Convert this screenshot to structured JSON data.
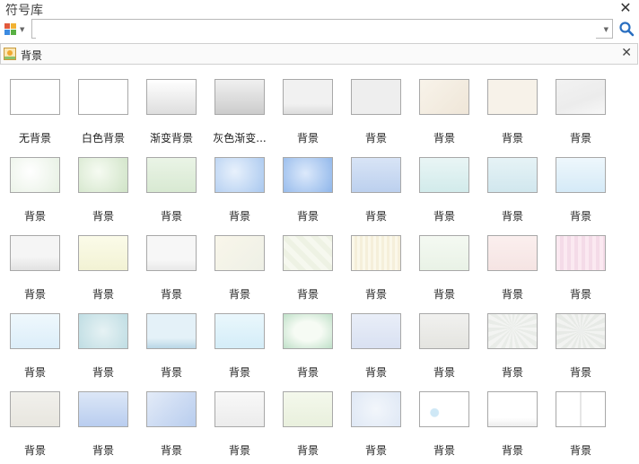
{
  "window": {
    "title": "符号库"
  },
  "search": {
    "value": "",
    "placeholder": ""
  },
  "library": {
    "name": "背景"
  },
  "items": [
    {
      "label": "无背景",
      "bg": "#ffffff"
    },
    {
      "label": "白色背景",
      "bg": "#ffffff"
    },
    {
      "label": "渐变背景",
      "bg": "linear-gradient(#ffffff,#dedede)"
    },
    {
      "label": "灰色渐变...",
      "bg": "linear-gradient(#f0f0f0,#cccccc)"
    },
    {
      "label": "背景",
      "bg": "linear-gradient(#f1f1f1 70%,#dcdcdc)"
    },
    {
      "label": "背景",
      "bg": "#eeeeee"
    },
    {
      "label": "背景",
      "bg": "linear-gradient(135deg,#f8f3ea,#efe6d8)"
    },
    {
      "label": "背景",
      "bg": "#f7f2e9"
    },
    {
      "label": "背景",
      "bg": "linear-gradient(160deg,#f2f2f2,#ececec 60%,#f7f7f7)"
    },
    {
      "label": "背景",
      "bg": "radial-gradient(circle at 40% 40%,#ffffff,#e6f0e2)"
    },
    {
      "label": "背景",
      "bg": "radial-gradient(circle at 40% 40%,#f6fbf2,#cfe3c6)"
    },
    {
      "label": "背景",
      "bg": "linear-gradient(#eaf4e6,#d8e9d2)"
    },
    {
      "label": "背景",
      "bg": "radial-gradient(circle at 40% 40%,#e8f1fc,#a9c8ef)"
    },
    {
      "label": "背景",
      "bg": "radial-gradient(circle at 45% 45%,#dce9fb,#8fb6ea)"
    },
    {
      "label": "背景",
      "bg": "linear-gradient(#d8e4f6,#bcd0ee)"
    },
    {
      "label": "背景",
      "bg": "linear-gradient(#e9f5f5,#d2ebeb)"
    },
    {
      "label": "背景",
      "bg": "linear-gradient(#e6f3f6,#d1e7ee)"
    },
    {
      "label": "背景",
      "bg": "linear-gradient(#eef7fc,#d5eaf7)"
    },
    {
      "label": "背景",
      "bg": "linear-gradient(#f5f5f5 60%,#e2e2e2)"
    },
    {
      "label": "背景",
      "bg": "linear-gradient(#fbfbe9,#f2f2d4)"
    },
    {
      "label": "背景",
      "bg": "linear-gradient(#f7f7f7 70%,#e9e9e9)"
    },
    {
      "label": "背景",
      "bg": "linear-gradient(135deg,#f9f6ea,#eef0e6)"
    },
    {
      "label": "背景",
      "bg": "repeating-linear-gradient(45deg,#eef2e4 0 6px,#f6f8ef 6px 12px)"
    },
    {
      "label": "背景",
      "bg": "repeating-linear-gradient(90deg,#fbf8ea 0 3px,#f5efda 3px 6px)"
    },
    {
      "label": "背景",
      "bg": "linear-gradient(#f4f9f2,#e9f2e6)"
    },
    {
      "label": "背景",
      "bg": "linear-gradient(#fbefee,#f5e4e3)"
    },
    {
      "label": "背景",
      "bg": "repeating-linear-gradient(90deg,#fbe9f1 0 4px,#f4dbe8 4px 8px)"
    },
    {
      "label": "背景",
      "bg": "linear-gradient(#eff8fd,#dceef9)"
    },
    {
      "label": "背景",
      "bg": "radial-gradient(circle at 50% 50%,#e6f2f4,#bfdde3)"
    },
    {
      "label": "背景",
      "bg": "linear-gradient(#e4f1f8 70%,#b9d6e6)"
    },
    {
      "label": "背景",
      "bg": "linear-gradient(#eaf7fc,#d4edf8)"
    },
    {
      "label": "背景",
      "bg": "radial-gradient(ellipse at 50% 50%,#f6fbf4 40%,#bfe0c8)"
    },
    {
      "label": "背景",
      "bg": "linear-gradient(#e9eef8,#d9e1f2)"
    },
    {
      "label": "背景",
      "bg": "linear-gradient(#f1f1ef,#e4e4e0)"
    },
    {
      "label": "背景",
      "bg": "repeating-conic-gradient(from 0deg at 50% 40%,#e9ece8 0 10deg,#f3f4f2 10deg 20deg)"
    },
    {
      "label": "背景",
      "bg": "repeating-conic-gradient(from 0deg at 50% 50%,#e7eae6 0 10deg,#f2f3f1 10deg 20deg)"
    },
    {
      "label": "背景",
      "bg": "linear-gradient(#f1f0ec,#e8e6df)"
    },
    {
      "label": "背景",
      "bg": "linear-gradient(#dce7f7,#b9cdef)"
    },
    {
      "label": "背景",
      "bg": "linear-gradient(135deg,#e3ebf8,#b8cdee)"
    },
    {
      "label": "背景",
      "bg": "linear-gradient(#f8f8f8,#ececec)"
    },
    {
      "label": "背景",
      "bg": "linear-gradient(#f4f8ec,#e9f0dd)"
    },
    {
      "label": "背景",
      "bg": "radial-gradient(circle at 50% 50%,#f2f6fb,#dfe8f5)"
    },
    {
      "label": "背景",
      "bg": "radial-gradient(circle at 30% 60%,#cfe8f6 0 10%,#ffffff 12%)"
    },
    {
      "label": "背景",
      "bg": "linear-gradient(#ffffff 75%,#eeeeee)"
    },
    {
      "label": "背景",
      "bg": "linear-gradient(90deg,#ffffff 49%,#cccccc 49% 51%,#ffffff 51%)"
    }
  ]
}
